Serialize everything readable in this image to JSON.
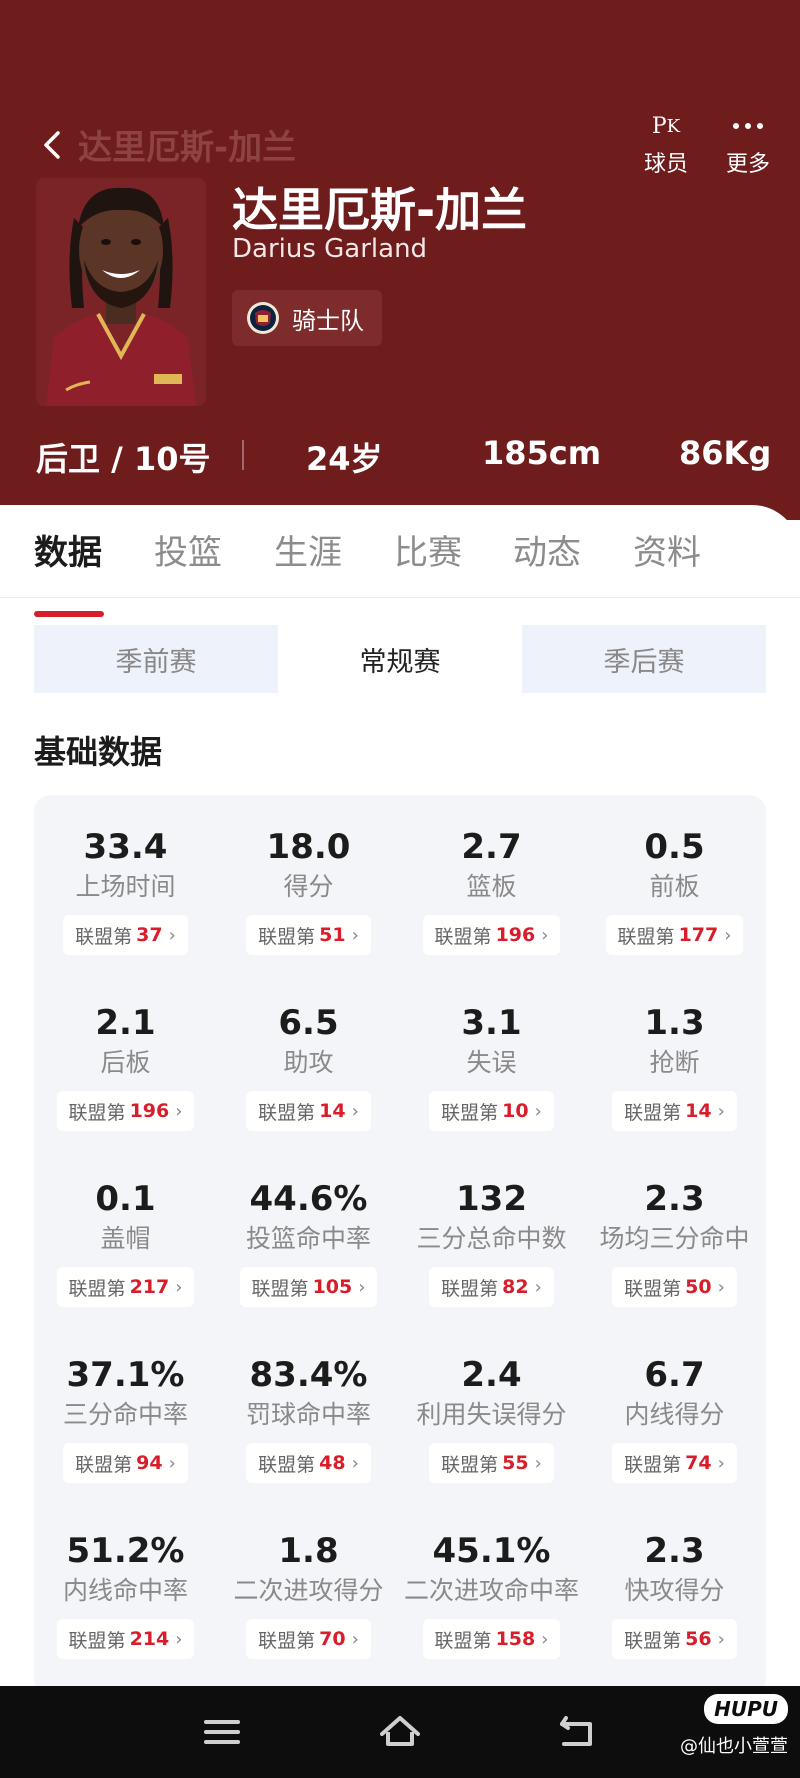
{
  "header": {
    "back_title": "达里厄斯-加兰",
    "actions": [
      {
        "label": "球员",
        "icon": "pk-icon"
      },
      {
        "label": "更多",
        "icon": "more-icon"
      }
    ],
    "player": {
      "name_cn": "达里厄斯-加兰",
      "name_en": "Darius Garland",
      "team": "骑士队"
    },
    "info": {
      "position": "后卫 / 10号",
      "age": "24岁",
      "height": "185cm",
      "weight": "86Kg"
    }
  },
  "tabs": [
    "数据",
    "投篮",
    "生涯",
    "比赛",
    "动态",
    "资料"
  ],
  "active_tab": "数据",
  "season_types": [
    "季前赛",
    "常规赛",
    "季后赛"
  ],
  "active_season_type": "常规赛",
  "section_title": "基础数据",
  "rank_prefix": "联盟第",
  "stats": [
    {
      "value": "33.4",
      "label": "上场时间",
      "rank": "37"
    },
    {
      "value": "18.0",
      "label": "得分",
      "rank": "51"
    },
    {
      "value": "2.7",
      "label": "篮板",
      "rank": "196"
    },
    {
      "value": "0.5",
      "label": "前板",
      "rank": "177"
    },
    {
      "value": "2.1",
      "label": "后板",
      "rank": "196"
    },
    {
      "value": "6.5",
      "label": "助攻",
      "rank": "14"
    },
    {
      "value": "3.1",
      "label": "失误",
      "rank": "10"
    },
    {
      "value": "1.3",
      "label": "抢断",
      "rank": "14"
    },
    {
      "value": "0.1",
      "label": "盖帽",
      "rank": "217"
    },
    {
      "value": "44.6%",
      "label": "投篮命中率",
      "rank": "105"
    },
    {
      "value": "132",
      "label": "三分总命中数",
      "rank": "82"
    },
    {
      "value": "2.3",
      "label": "场均三分命中",
      "rank": "50"
    },
    {
      "value": "37.1%",
      "label": "三分命中率",
      "rank": "94"
    },
    {
      "value": "83.4%",
      "label": "罚球命中率",
      "rank": "48"
    },
    {
      "value": "2.4",
      "label": "利用失误得分",
      "rank": "55"
    },
    {
      "value": "6.7",
      "label": "内线得分",
      "rank": "74"
    },
    {
      "value": "51.2%",
      "label": "内线命中率",
      "rank": "214"
    },
    {
      "value": "1.8",
      "label": "二次进攻得分",
      "rank": "70"
    },
    {
      "value": "45.1%",
      "label": "二次进攻命中率",
      "rank": "158"
    },
    {
      "value": "2.3",
      "label": "快攻得分",
      "rank": "56"
    }
  ],
  "nav": {
    "icons": [
      "menu-icon",
      "home-icon",
      "back-nav-icon"
    ],
    "logo": "HUPU",
    "watermark": "@仙也小萱萱"
  },
  "colors": {
    "header_bg": "#6e1c1c",
    "accent_red": "#d81e2a",
    "stats_bg": "#f4f5f8",
    "segment_bg": "#eef2fa"
  }
}
